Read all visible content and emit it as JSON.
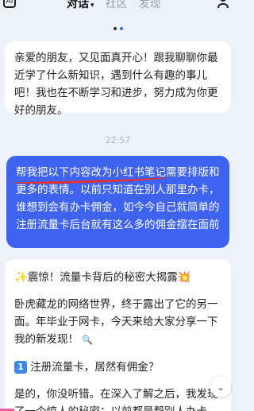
{
  "header": {
    "left_icon_label": "AI",
    "tabs": [
      {
        "label": "对话",
        "active": true
      },
      {
        "label": "社区",
        "active": false
      },
      {
        "label": "发现",
        "active": false
      }
    ],
    "chevron": "▾"
  },
  "messages": {
    "assistant_greeting": "亲爱的朋友，又见面真开心！跟我聊聊你最近学了什么新知识，遇到什么有趣的事儿吧！我也在不断学习和进步，努力成为你更好的朋友。",
    "timestamp": "22:57",
    "user_message": "帮我把以下内容改为小红书笔记需要排版和更多的表情。以前只知道在别人那里办卡，谁想到会有办卡佣金，如今今自己就简单的注册流量卡后台就有这么多的佣金摆在面前",
    "reply": {
      "title_sparkle": "✨",
      "title": "震惊！流量卡背后的秘密大揭露",
      "title_boom": "💥",
      "para1": "卧虎藏龙的网络世界，终于露出了它的另一面。年毕业于网卡，今天来给大家分享一下我的新发现！",
      "para1_icon": "🔍",
      "item1_num": "1",
      "item1": "注册流量卡，居然有佣金？",
      "para2": "是的，你没听错。在深入了解之后，我发现了一个惊人的秘密：以前都是帮别人办卡"
    }
  },
  "controls": {
    "scroll_down": "⌄"
  }
}
